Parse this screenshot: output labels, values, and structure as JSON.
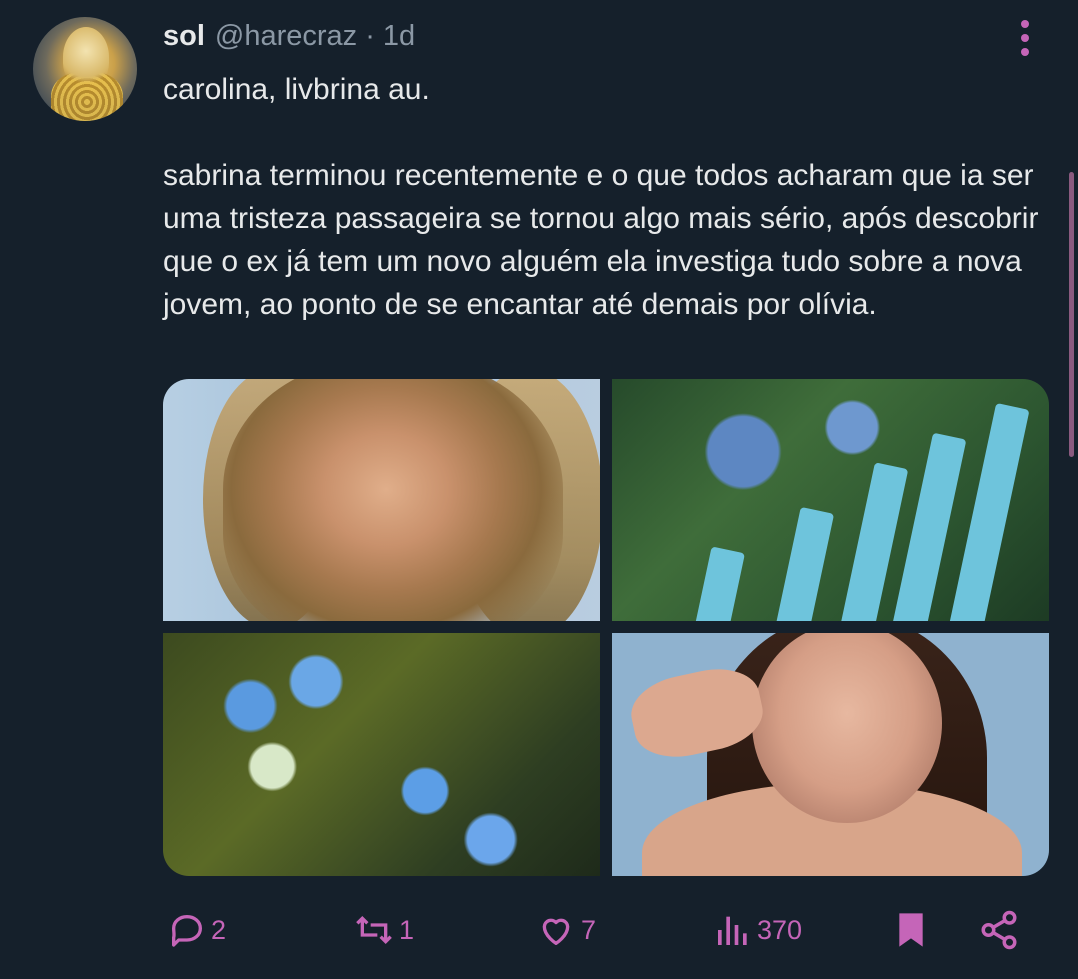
{
  "tweet": {
    "author_name": "sol",
    "author_handle": "@harecraz",
    "separator": "·",
    "time": "1d",
    "text": "carolina, livbrina au.\n\nsabrina terminou recentemente e o que todos acharam que ia ser uma tristeza passageira se tornou algo mais sério, após descobrir que o ex já tem um novo alguém ela investiga tudo sobre a nova jovem, ao ponto de se encantar até demais por olívia."
  },
  "actions": {
    "replies": "2",
    "retweets": "1",
    "likes": "7",
    "views": "370"
  },
  "colors": {
    "background": "#15202b",
    "accent": "#c565b8",
    "text": "#e7e9ea",
    "muted": "#8b98a5"
  },
  "icons": [
    "reply-icon",
    "retweet-icon",
    "like-icon",
    "views-icon",
    "bookmark-icon",
    "share-icon",
    "more-icon"
  ]
}
